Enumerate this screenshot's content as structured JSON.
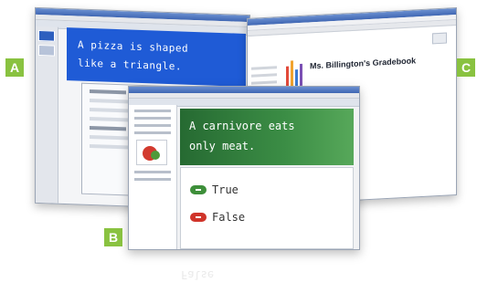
{
  "labels": {
    "a": "A",
    "b": "B",
    "c": "C"
  },
  "window_a": {
    "slide_line1": "A pizza is shaped",
    "slide_line2": "like a triangle."
  },
  "window_b": {
    "question_line1": "A carnivore eats",
    "question_line2": "only meat.",
    "answer_true": "True",
    "answer_false": "False",
    "true_color": "#3e8f3a",
    "false_color": "#d0342a",
    "reflection_text": "False"
  },
  "window_c": {
    "gradebook_title": "Ms. Billington's Gradebook"
  },
  "colors": {
    "label_green": "#89c240",
    "slide_blue": "#1f5bd6",
    "question_green": "#2f7d3b"
  }
}
